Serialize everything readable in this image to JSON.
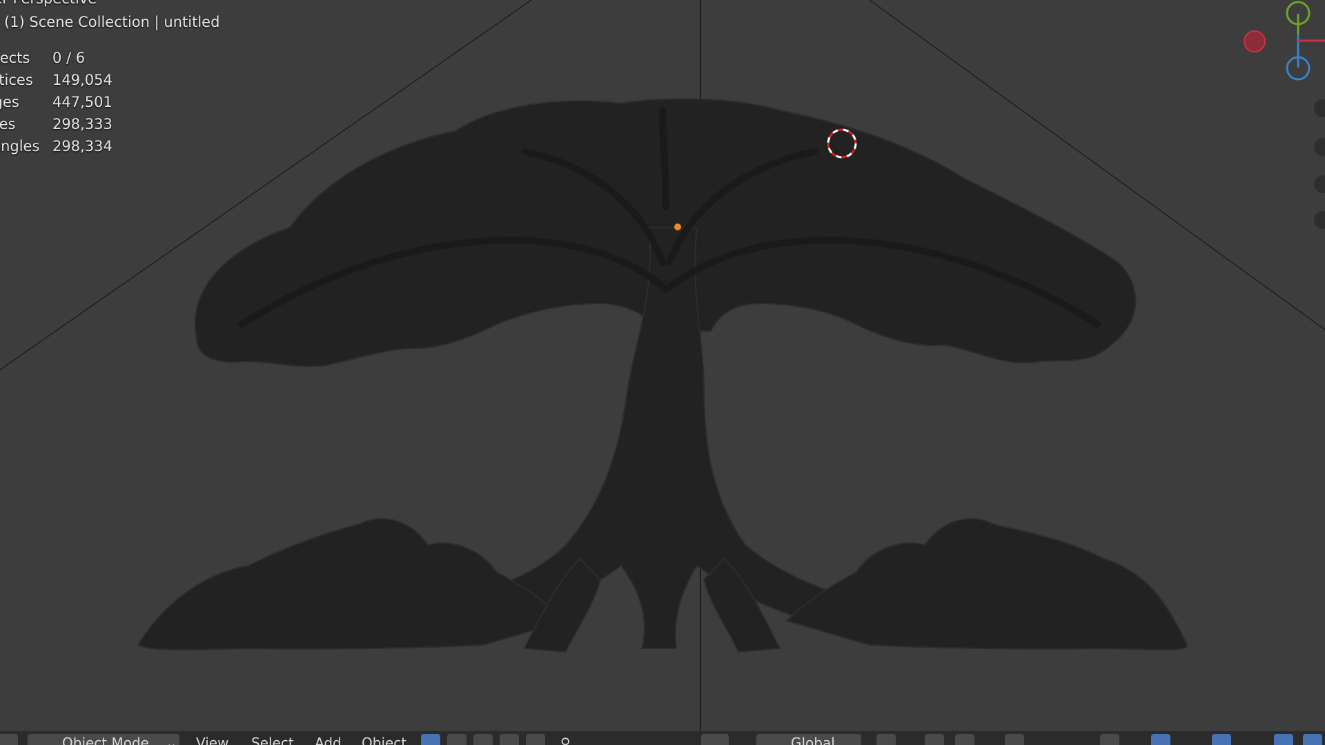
{
  "viewport": {
    "view_name": "User Perspective",
    "collection_label": "(1) Scene Collection | untitled",
    "stats": [
      {
        "label": "Objects",
        "value": "0 / 6"
      },
      {
        "label": "Vertices",
        "value": "149,054"
      },
      {
        "label": "Edges",
        "value": "447,501"
      },
      {
        "label": "Faces",
        "value": "298,333"
      },
      {
        "label": "Triangles",
        "value": "298,334"
      }
    ]
  },
  "gizmo": {
    "colors": {
      "x": "#d03043",
      "y": "#6fa526",
      "z": "#3b82c9"
    }
  },
  "header": {
    "mode": "Object Mode",
    "menus": [
      "View",
      "Select",
      "Add",
      "Object"
    ],
    "transform_orientation": "Global"
  },
  "colors": {
    "viewport_bg": "#3d3d3d",
    "header_bg": "#2b2b2b",
    "accent": "#4772b3",
    "origin_dot": "#f08a24"
  }
}
